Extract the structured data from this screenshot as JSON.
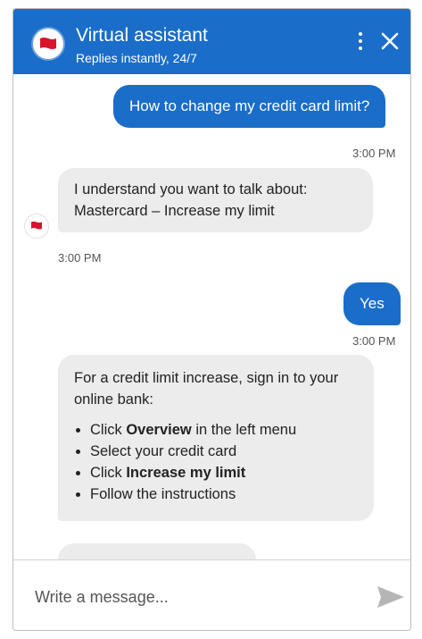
{
  "header": {
    "title": "Virtual assistant",
    "subtitle": "Replies instantly, 24/7"
  },
  "icons": {
    "avatar": "red-flag-icon",
    "menu": "more-vertical-icon",
    "close": "close-icon",
    "send": "send-icon"
  },
  "colors": {
    "brand": "#1a6dc9",
    "user_bubble": "#1a6dc9",
    "bot_bubble": "#ececec",
    "logo_red": "#d8142b"
  },
  "messages": {
    "m1": {
      "sender": "user",
      "text": "How to change my credit card limit?",
      "time": "3:00 PM"
    },
    "m2": {
      "sender": "bot",
      "line1": "I understand you want to talk about:",
      "line2": "Mastercard – Increase my limit",
      "time": "3:00 PM"
    },
    "m3": {
      "sender": "user",
      "text": "Yes",
      "time": "3:00 PM"
    },
    "m4": {
      "sender": "bot",
      "intro": "For a credit limit increase, sign in to your online bank:",
      "b1_pre": "Click ",
      "b1_bold": "Overview",
      "b1_post": " in the left menu",
      "b2": "Select your credit card",
      "b3_pre": "Click ",
      "b3_bold": "Increase my limit",
      "b4": "Follow the instructions"
    }
  },
  "composer": {
    "placeholder": "Write a message..."
  }
}
